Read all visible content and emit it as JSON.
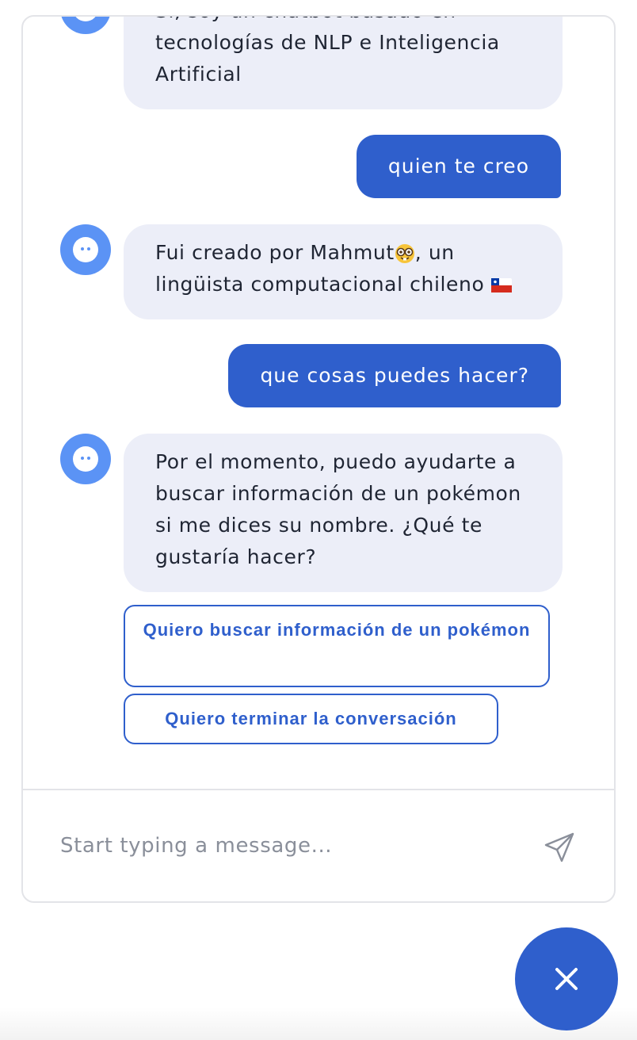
{
  "conversation": {
    "messages": [
      {
        "from": "bot",
        "text": "Sí, soy un chatbot basado en tecnologías de NLP e Inteligencia Artificial"
      },
      {
        "from": "user",
        "text": "quien te creo"
      },
      {
        "from": "bot",
        "text_before_emoji": "Fui creado por Mahmut",
        "text_after_emoji": ", un lingüista computacional chileno",
        "emojis": [
          "nerd-face-emoji",
          "chile-flag-emoji"
        ]
      },
      {
        "from": "user",
        "text": "que cosas puedes hacer?"
      },
      {
        "from": "bot",
        "text": "Por el momento, puedo ayudarte a buscar información de un pokémon si me dices su nombre. ¿Qué te gustaría hacer?"
      }
    ],
    "quick_replies": [
      {
        "label": "Quiero buscar información de un pokémon"
      },
      {
        "label": "Quiero terminar la conversación"
      }
    ]
  },
  "composer": {
    "placeholder": "Start typing a message...",
    "send_icon": "paper-plane-icon"
  },
  "launcher": {
    "close_icon": "close-icon"
  },
  "colors": {
    "accent": "#2f5fcc",
    "avatar": "#5b93f5",
    "bot_bubble": "#eceef8"
  }
}
